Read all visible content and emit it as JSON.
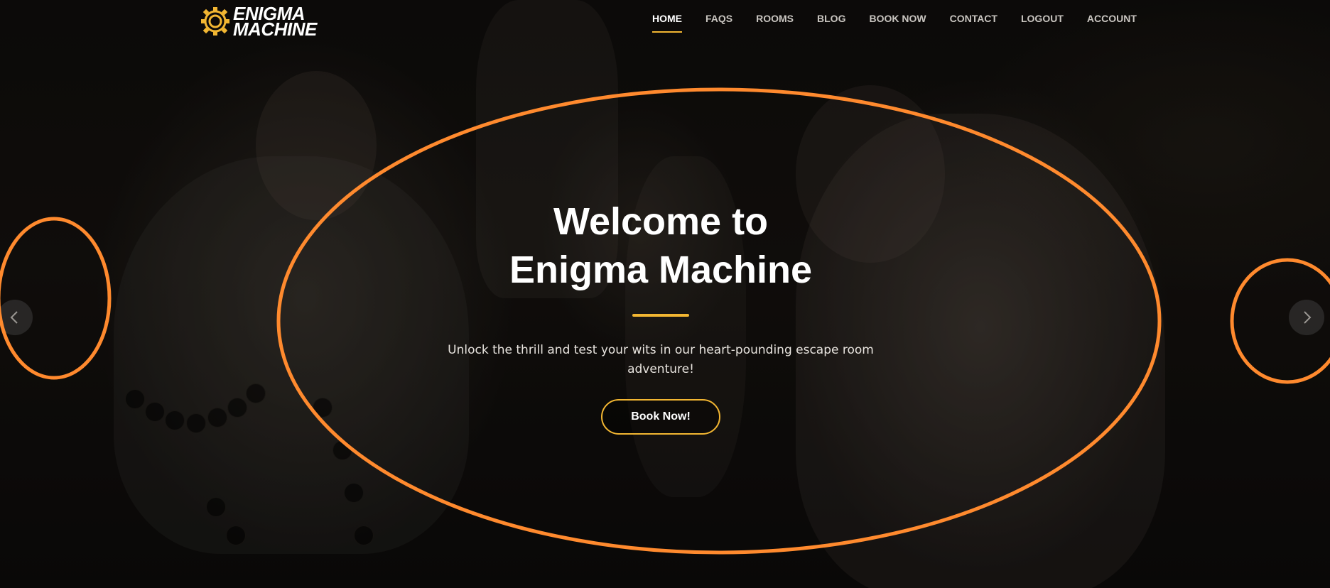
{
  "brand": {
    "line1": "ENIGMA",
    "line2": "MACHINE",
    "icon": "gear-icon",
    "accent_color": "#f2b632"
  },
  "nav": {
    "items": [
      {
        "label": "HOME",
        "active": true
      },
      {
        "label": "FAQS"
      },
      {
        "label": "ROOMS"
      },
      {
        "label": "BLOG"
      },
      {
        "label": "BOOK NOW"
      },
      {
        "label": "CONTACT"
      },
      {
        "label": "LOGOUT"
      },
      {
        "label": "ACCOUNT"
      }
    ]
  },
  "hero": {
    "title_line1": "Welcome to",
    "title_line2": "Enigma Machine",
    "subtitle": "Unlock the thrill and test your wits in our heart-pounding escape room adventure!",
    "cta_label": "Book Now!"
  },
  "slider": {
    "prev_icon": "chevron-left-icon",
    "next_icon": "chevron-right-icon"
  },
  "annotation_color": "#ff8a2e"
}
